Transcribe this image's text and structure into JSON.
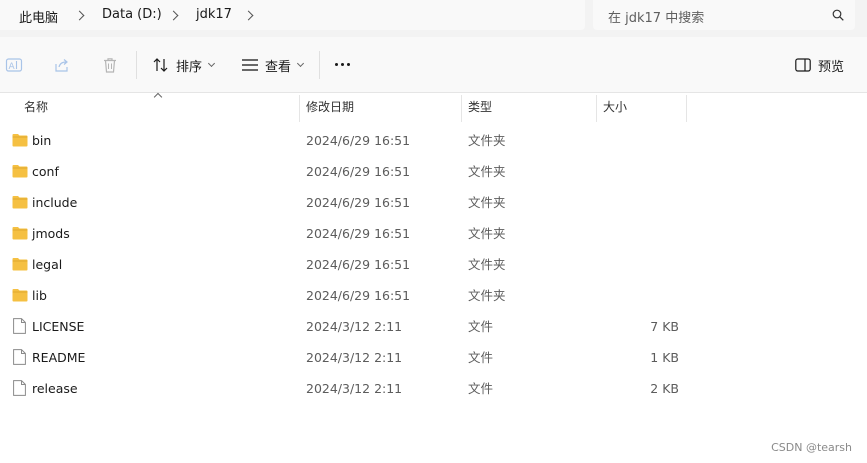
{
  "breadcrumb": {
    "items": [
      "此电脑",
      "Data (D:)",
      "jdk17"
    ]
  },
  "search": {
    "placeholder": "在 jdk17 中搜索"
  },
  "toolbar": {
    "sort_label": "排序",
    "view_label": "查看",
    "preview_label": "预览"
  },
  "columns": {
    "name": "名称",
    "date": "修改日期",
    "type": "类型",
    "size": "大小"
  },
  "files": [
    {
      "name": "bin",
      "date": "2024/6/29 16:51",
      "type": "文件夹",
      "size": "",
      "kind": "folder"
    },
    {
      "name": "conf",
      "date": "2024/6/29 16:51",
      "type": "文件夹",
      "size": "",
      "kind": "folder"
    },
    {
      "name": "include",
      "date": "2024/6/29 16:51",
      "type": "文件夹",
      "size": "",
      "kind": "folder"
    },
    {
      "name": "jmods",
      "date": "2024/6/29 16:51",
      "type": "文件夹",
      "size": "",
      "kind": "folder"
    },
    {
      "name": "legal",
      "date": "2024/6/29 16:51",
      "type": "文件夹",
      "size": "",
      "kind": "folder"
    },
    {
      "name": "lib",
      "date": "2024/6/29 16:51",
      "type": "文件夹",
      "size": "",
      "kind": "folder"
    },
    {
      "name": "LICENSE",
      "date": "2024/3/12 2:11",
      "type": "文件",
      "size": "7 KB",
      "kind": "file"
    },
    {
      "name": "README",
      "date": "2024/3/12 2:11",
      "type": "文件",
      "size": "1 KB",
      "kind": "file"
    },
    {
      "name": "release",
      "date": "2024/3/12 2:11",
      "type": "文件",
      "size": "2 KB",
      "kind": "file"
    }
  ],
  "watermark": "CSDN @tearsh",
  "colors": {
    "folder_yellow": "#f5c042",
    "folder_dark": "#e0a82e",
    "file_outline": "#8a8a8a",
    "accent": "#0067c0"
  }
}
